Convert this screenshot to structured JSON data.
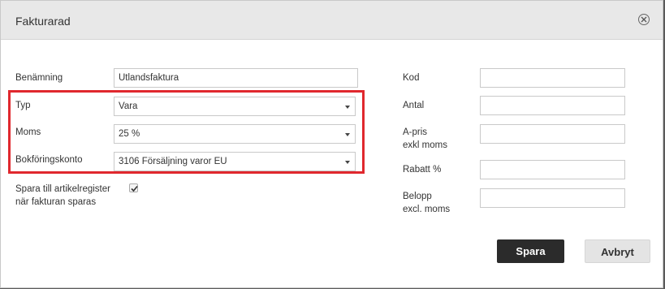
{
  "dialog": {
    "title": "Fakturarad"
  },
  "left": {
    "name_label": "Benämning",
    "name_value": "Utlandsfaktura",
    "type_label": "Typ",
    "type_value": "Vara",
    "vat_label": "Moms",
    "vat_value": "25 %",
    "account_label": "Bokföringskonto",
    "account_value": "3106 Försäljning varor EU",
    "save_article_label_line1": "Spara till artikelregister",
    "save_article_label_line2": "när fakturan sparas",
    "save_article_checked": true
  },
  "right": {
    "code_label": "Kod",
    "code_value": "",
    "qty_label": "Antal",
    "qty_value": "",
    "price_label_line1": "A-pris",
    "price_label_line2": "exkl moms",
    "price_value": "",
    "discount_label": "Rabatt %",
    "discount_value": "",
    "amount_label_line1": "Belopp",
    "amount_label_line2": "excl. moms",
    "amount_value": ""
  },
  "buttons": {
    "save": "Spara",
    "cancel": "Avbryt"
  },
  "icons": {
    "close": "close-circle-icon",
    "caret": "caret-down-icon",
    "check": "checkmark-icon"
  },
  "colors": {
    "highlight": "#e0282e",
    "primary_button": "#2b2b2b",
    "header_bg": "#e8e8e8"
  }
}
